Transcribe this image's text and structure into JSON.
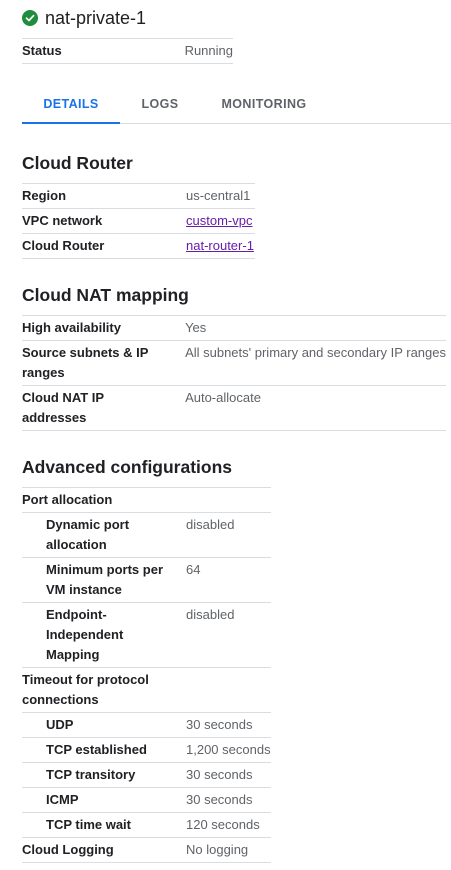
{
  "header": {
    "title": "nat-private-1",
    "status_icon": "check-circle-icon",
    "status_color": "#1e8e3e"
  },
  "status": {
    "label": "Status",
    "value": "Running"
  },
  "tabs": [
    {
      "label": "DETAILS",
      "active": true
    },
    {
      "label": "LOGS",
      "active": false
    },
    {
      "label": "MONITORING",
      "active": false
    }
  ],
  "accent_color": "#1a73e8",
  "cloud_router": {
    "title": "Cloud Router",
    "region_label": "Region",
    "region_value": "us-central1",
    "vpc_label": "VPC network",
    "vpc_value": "custom-vpc",
    "router_label": "Cloud Router",
    "router_value": "nat-router-1"
  },
  "nat_mapping": {
    "title": "Cloud NAT mapping",
    "ha_label": "High availability",
    "ha_value": "Yes",
    "subnets_label": "Source subnets & IP ranges",
    "subnets_value": "All subnets' primary and secondary IP ranges",
    "ips_label": "Cloud NAT IP addresses",
    "ips_value": "Auto-allocate"
  },
  "advanced": {
    "title": "Advanced configurations",
    "port_allocation_label": "Port allocation",
    "dynamic_port_label": "Dynamic port allocation",
    "dynamic_port_value": "disabled",
    "min_ports_label": "Minimum ports per VM instance",
    "min_ports_value": "64",
    "eim_label": "Endpoint-Independent Mapping",
    "eim_value": "disabled",
    "timeout_label": "Timeout for protocol connections",
    "udp_label": "UDP",
    "udp_value": "30 seconds",
    "tcp_est_label": "TCP established",
    "tcp_est_value": "1,200 seconds",
    "tcp_trans_label": "TCP transitory",
    "tcp_trans_value": "30 seconds",
    "icmp_label": "ICMP",
    "icmp_value": "30 seconds",
    "tcp_wait_label": "TCP time wait",
    "tcp_wait_value": "120 seconds",
    "logging_label": "Cloud Logging",
    "logging_value": "No logging"
  }
}
